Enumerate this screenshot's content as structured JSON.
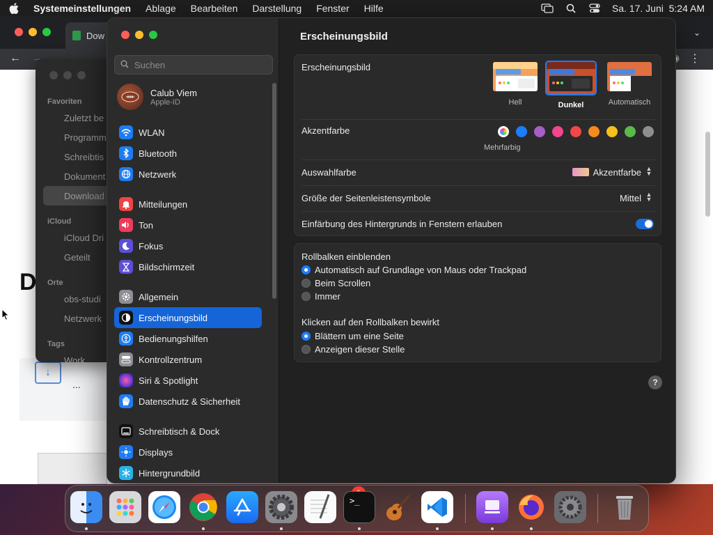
{
  "menubar": {
    "app": "Systemeinstellungen",
    "items": [
      "Ablage",
      "Bearbeiten",
      "Darstellung",
      "Fenster",
      "Hilfe"
    ],
    "datetime": "Sa. 17. Juni  5:24 AM"
  },
  "browser": {
    "tab_title": "Dow",
    "partial_text": "...",
    "heading_fragment": "D"
  },
  "finder": {
    "favorites_header": "Favoriten",
    "favorites": [
      "Zuletzt be",
      "Programm",
      "Schreibtis",
      "Dokument",
      "Download"
    ],
    "icloud_header": "iCloud",
    "icloud": [
      "iCloud Dri",
      "Geteilt"
    ],
    "orte_header": "Orte",
    "orte": [
      "obs-studi",
      "Netzwerk"
    ],
    "tags_header": "Tags",
    "tags": [
      "Work"
    ]
  },
  "settings": {
    "search_placeholder": "Suchen",
    "account": {
      "name": "Calub Viem",
      "sub": "Apple-ID"
    },
    "sidebar": [
      {
        "label": "WLAN",
        "icon": "wifi-icon",
        "color": "#1e7cf2"
      },
      {
        "label": "Bluetooth",
        "icon": "bluetooth-icon",
        "color": "#1e7cf2"
      },
      {
        "label": "Netzwerk",
        "icon": "globe-icon",
        "color": "#1e7cf2"
      },
      {
        "label": "Mitteilungen",
        "icon": "bell-icon",
        "color": "#ef4444"
      },
      {
        "label": "Ton",
        "icon": "speaker-icon",
        "color": "#ef3b5a"
      },
      {
        "label": "Fokus",
        "icon": "moon-icon",
        "color": "#5b4fd8"
      },
      {
        "label": "Bildschirmzeit",
        "icon": "hourglass-icon",
        "color": "#5b4fd8"
      },
      {
        "label": "Allgemein",
        "icon": "gear-icon",
        "color": "#8e8e93"
      },
      {
        "label": "Erscheinungsbild",
        "icon": "appearance-icon",
        "color": "#111111"
      },
      {
        "label": "Bedienungshilfen",
        "icon": "accessibility-icon",
        "color": "#1e7cf2"
      },
      {
        "label": "Kontrollzentrum",
        "icon": "control-center-icon",
        "color": "#8e8e93"
      },
      {
        "label": "Siri & Spotlight",
        "icon": "siri-icon",
        "color": "#b13ed8"
      },
      {
        "label": "Datenschutz & Sicherheit",
        "icon": "hand-icon",
        "color": "#1e7cf2"
      },
      {
        "label": "Schreibtisch & Dock",
        "icon": "dock-icon",
        "color": "#111111"
      },
      {
        "label": "Displays",
        "icon": "sun-icon",
        "color": "#1e7cf2"
      },
      {
        "label": "Hintergrundbild",
        "icon": "snowflake-icon",
        "color": "#2ab2e8"
      }
    ],
    "content": {
      "title": "Erscheinungsbild",
      "appearance_label": "Erscheinungsbild",
      "appearance_options": [
        "Hell",
        "Dunkel",
        "Automatisch"
      ],
      "appearance_selected": "Dunkel",
      "accent_label": "Akzentfarbe",
      "accent_colors": [
        "multicolor",
        "#1c7dff",
        "#a75ec9",
        "#f2468f",
        "#f04848",
        "#f58a1e",
        "#f5c01e",
        "#5ab94a",
        "#8e8e8e"
      ],
      "accent_selected_label": "Mehrfarbig",
      "highlight_label": "Auswahlfarbe",
      "highlight_value": "Akzentfarbe",
      "sidebar_size_label": "Größe der Seitenleistensymbole",
      "sidebar_size_value": "Mittel",
      "tinting_label": "Einfärbung des Hintergrunds in Fenstern erlauben",
      "tinting_on": true,
      "scroll_label": "Rollbalken einblenden",
      "scroll_options": [
        "Automatisch auf Grundlage von Maus oder Trackpad",
        "Beim Scrollen",
        "Immer"
      ],
      "scroll_selected": 0,
      "click_label": "Klicken auf den Rollbalken bewirkt",
      "click_options": [
        "Blättern um eine Seite",
        "Anzeigen dieser Stelle"
      ],
      "click_selected": 0,
      "help": "?"
    }
  },
  "dock": {
    "apps": [
      "finder",
      "launchpad",
      "safari",
      "chrome",
      "app-store",
      "system-settings",
      "textedit",
      "terminal",
      "garageband",
      "vscode",
      "podcasts",
      "firefox",
      "settings-gear",
      "trash"
    ],
    "badge": "1"
  }
}
